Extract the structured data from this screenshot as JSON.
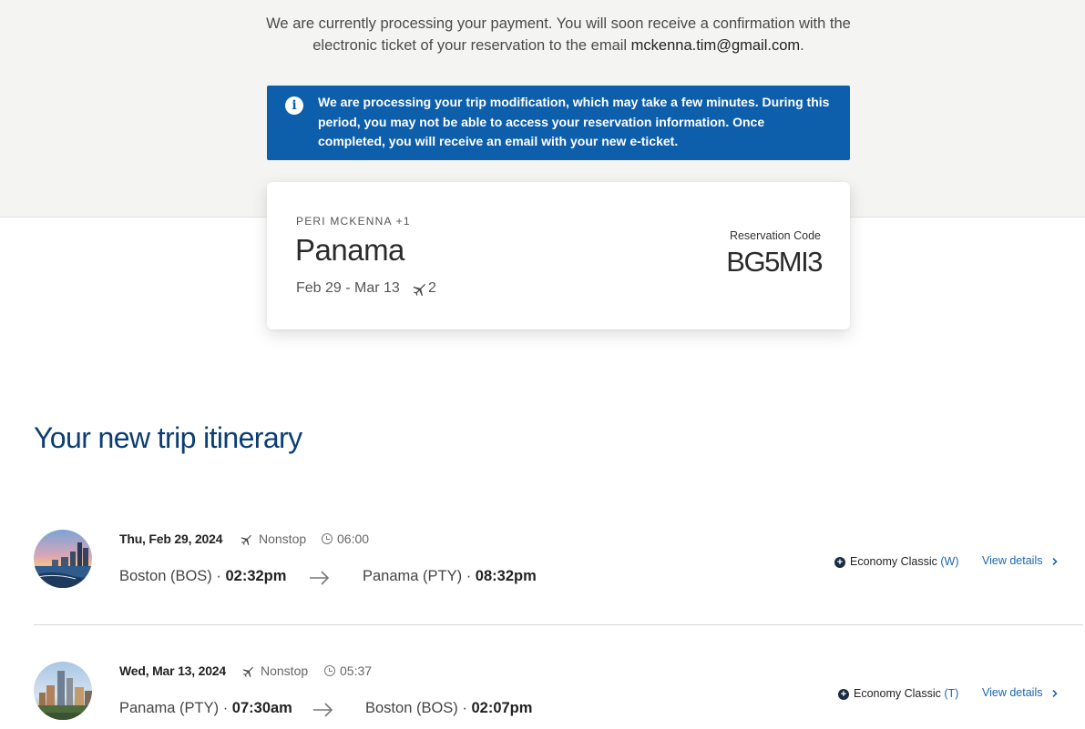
{
  "processing": {
    "line1": "We are currently processing your payment. You will soon receive a confirmation with the",
    "line2_prefix": "electronic ticket of your reservation to the email ",
    "email": "mckenna.tim@gmail.com",
    "line2_suffix": "."
  },
  "banner": {
    "text": "We are processing your trip modification, which may take a few minutes. During this period, you may not be able to access your reservation information. Once completed, you will receive an email with your new e-ticket."
  },
  "reservation": {
    "passenger": "PERI MCKENNA +1",
    "destination": "Panama",
    "dates": "Feb 29 - Mar 13",
    "flight_count": "2",
    "code_label": "Reservation Code",
    "code": "BG5MI3"
  },
  "itinerary": {
    "title": "Your new trip itinerary",
    "flights": [
      {
        "date": "Thu, Feb 29, 2024",
        "stops": "Nonstop",
        "duration": "06:00",
        "origin_city": "Boston (BOS)",
        "origin_time": "02:32pm",
        "dest_city": "Panama (PTY)",
        "dest_time": "08:32pm",
        "fare": "Economy Classic",
        "fare_class": "(W)",
        "details_label": "View details"
      },
      {
        "date": "Wed, Mar 13, 2024",
        "stops": "Nonstop",
        "duration": "05:37",
        "origin_city": "Panama (PTY)",
        "origin_time": "07:30am",
        "dest_city": "Boston (BOS)",
        "dest_time": "02:07pm",
        "fare": "Economy Classic",
        "fare_class": "(T)",
        "details_label": "View details"
      }
    ]
  },
  "colors": {
    "banner_bg": "#0d5fac",
    "title": "#0b3e73",
    "link": "#1b66b0"
  },
  "icons": {
    "info": "info-icon",
    "plane": "plane-icon",
    "clock": "clock-icon",
    "arrow": "arrow-right-icon",
    "chevron": "chevron-right-icon",
    "plus": "plus-circle-icon"
  }
}
